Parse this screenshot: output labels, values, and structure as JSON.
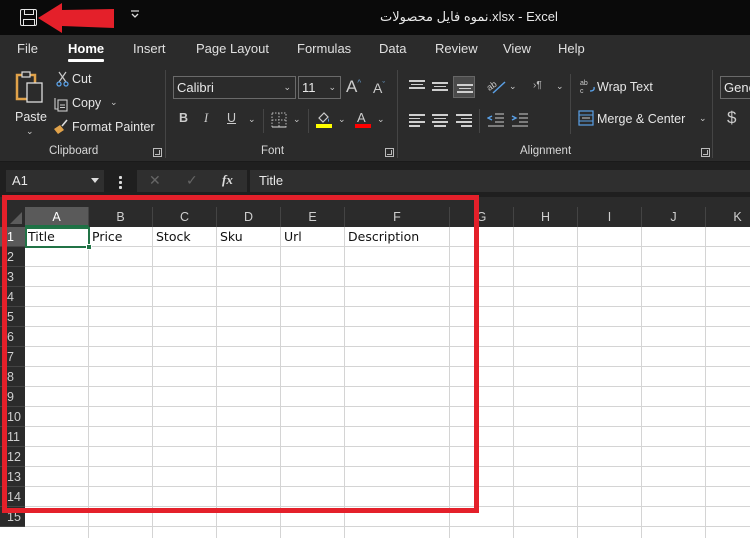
{
  "titlebar": {
    "title": "نموه فایل محصولات.xlsx  -  Excel",
    "save_icon": "save-icon",
    "qat_dropdown_glyph": "⏷"
  },
  "annotation": {
    "arrow_color": "#e4202a",
    "highlight_color": "#e4202a"
  },
  "menu": {
    "tabs": [
      {
        "label": "File"
      },
      {
        "label": "Home",
        "active": true
      },
      {
        "label": "Insert"
      },
      {
        "label": "Page Layout"
      },
      {
        "label": "Formulas"
      },
      {
        "label": "Data"
      },
      {
        "label": "Review"
      },
      {
        "label": "View"
      },
      {
        "label": "Help"
      }
    ]
  },
  "ribbon": {
    "clipboard": {
      "label": "Clipboard",
      "paste": "Paste",
      "cut": "Cut",
      "copy": "Copy",
      "format_painter": "Format Painter"
    },
    "font": {
      "label": "Font",
      "font_name": "Calibri",
      "font_size": "11",
      "bold": "B",
      "italic": "I",
      "underline": "U",
      "highlight_color": "#ffff00",
      "font_color": "#ff0000"
    },
    "alignment": {
      "label": "Alignment",
      "wrap_text": "Wrap Text",
      "merge_center": "Merge & Center"
    },
    "number": {
      "format": "General",
      "currency": "$"
    }
  },
  "formula_bar": {
    "name_box": "A1",
    "fx": "fx",
    "cancel": "✕",
    "enter": "✓",
    "value": "Title"
  },
  "sheet": {
    "columns": [
      "A",
      "B",
      "C",
      "D",
      "E",
      "F",
      "G",
      "H",
      "I",
      "J",
      "K"
    ],
    "rows": [
      "1",
      "2",
      "3",
      "4",
      "5",
      "6",
      "7",
      "8",
      "9",
      "10",
      "11",
      "12",
      "13",
      "14",
      "15"
    ],
    "selected_cell": "A1",
    "row1": [
      "Title",
      "Price",
      "Stock",
      "Sku",
      "Url",
      "Description"
    ]
  }
}
